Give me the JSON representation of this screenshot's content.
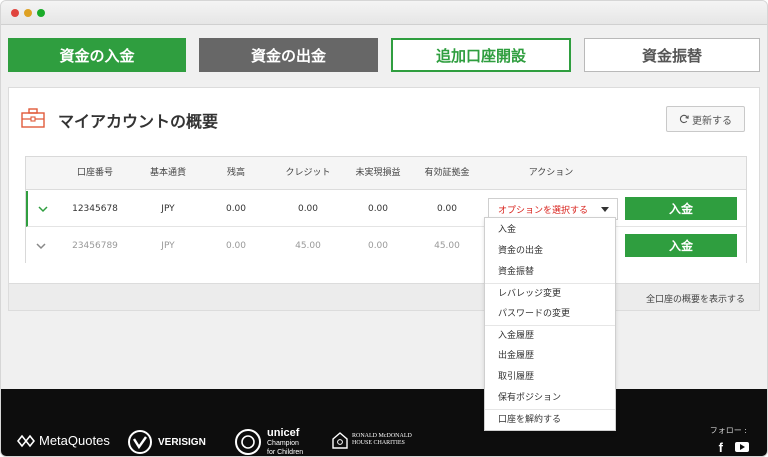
{
  "tabs": [
    {
      "label": "資金の入金"
    },
    {
      "label": "資金の出金"
    },
    {
      "label": "追加口座開設"
    },
    {
      "label": "資金振替"
    }
  ],
  "panel": {
    "title": "マイアカウントの概要",
    "refresh_label": "更新する",
    "show_all_label": "全口座の概要を表示する"
  },
  "table": {
    "headers": [
      "口座番号",
      "基本通貨",
      "残高",
      "クレジット",
      "未実現損益",
      "有効証拠金",
      "アクション"
    ],
    "rows": [
      {
        "account": "12345678",
        "currency": "JPY",
        "balance": "0.00",
        "credit": "0.00",
        "unrealized": "0.00",
        "equity": "0.00",
        "action_select": "オプションを選択する",
        "deposit_label": "入金"
      },
      {
        "account": "23456789",
        "currency": "JPY",
        "balance": "0.00",
        "credit": "45.00",
        "unrealized": "0.00",
        "equity": "45.00",
        "deposit_label": "入金"
      }
    ]
  },
  "dropdown": {
    "items": [
      "入金",
      "資金の出金",
      "資金振替",
      "レバレッジ変更",
      "パスワードの変更",
      "入金履歴",
      "出金履歴",
      "取引履歴",
      "保有ポジション",
      "口座を解約する"
    ]
  },
  "footer": {
    "metaquotes": "MetaQuotes",
    "verisign": "VERISIGN",
    "unicef_1": "unicef",
    "unicef_2": "Champion",
    "unicef_3": "for Children",
    "rmhc_1": "RONALD McDONALD",
    "rmhc_2": "HOUSE CHARITIES",
    "follow": "フォロー :",
    "facebook": "f"
  },
  "colors": {
    "accent_green": "#2f9e3f",
    "grey_tab": "#676767",
    "select_red": "#d9231d",
    "footer_bg": "#0d0d0d"
  },
  "icons": [
    "briefcase-icon",
    "refresh-icon",
    "chevron-down-icon",
    "caret-down-icon",
    "facebook-icon",
    "youtube-icon"
  ]
}
